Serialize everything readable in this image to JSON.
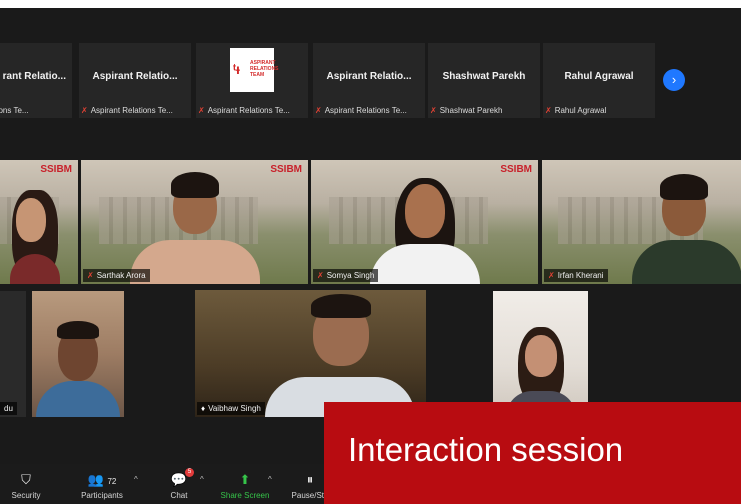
{
  "strip": {
    "tiles": [
      {
        "name": "rant Relatio...",
        "bar": "rant Relations Te..."
      },
      {
        "name": "Aspirant  Relatio...",
        "bar": "Aspirant Relations Te..."
      },
      {
        "name": "",
        "bar": "Aspirant Relations Te...",
        "logo_text": "ASPIRANT RELATIONS TEAM"
      },
      {
        "name": "Aspirant  Relatio...",
        "bar": "Aspirant Relations Te..."
      },
      {
        "name": "Shashwat Parekh",
        "bar": "Shashwat Parekh"
      },
      {
        "name": "Rahul Agrawal",
        "bar": "Rahul Agrawal"
      }
    ]
  },
  "videos": {
    "sarthak": "Sarthak Arora",
    "somya": "Somya Singh",
    "irfan": "Irfan Kherani",
    "partial_left": "du",
    "vaibhaw": "Vaibhaw Singh"
  },
  "watermark": "SSIBM",
  "toolbar": {
    "security": "Security",
    "participants": "Participants",
    "participants_count": "72",
    "chat": "Chat",
    "chat_badge": "5",
    "share_screen": "Share Screen",
    "pause": "Pause/Sto"
  },
  "banner": {
    "text": "Interaction session"
  },
  "colors": {
    "banner": "#b80c11",
    "accent_blue": "#1f78ff",
    "share_green": "#36c44a",
    "active_speaker": "#c8d94a"
  }
}
